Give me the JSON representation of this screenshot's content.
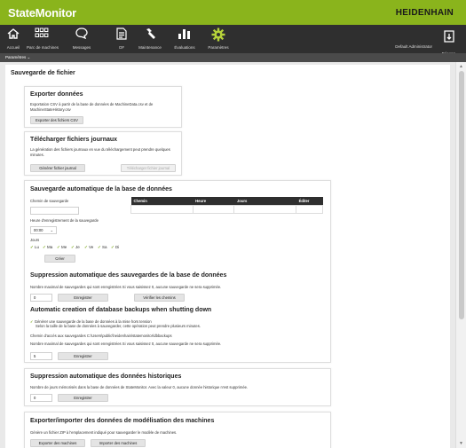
{
  "app": {
    "name": "StateMonitor",
    "vendor": "HEIDENHAIN"
  },
  "nav": {
    "items": [
      {
        "label": "Accueil",
        "icon": "home-icon"
      },
      {
        "label": "Parc de machines",
        "icon": "grid-icon"
      },
      {
        "label": "Messages",
        "icon": "message-icon"
      },
      {
        "label": "OF",
        "icon": "document-icon"
      },
      {
        "label": "Maintenance",
        "icon": "wrench-icon"
      },
      {
        "label": "Évaluations",
        "icon": "bar-chart-icon"
      },
      {
        "label": "Paramètres",
        "icon": "gear-icon"
      }
    ],
    "user": "Default Administrator",
    "logout": "Déconn."
  },
  "breadcrumb": "Paramètres ⌄",
  "page_title": "Sauvegarde de fichier",
  "export": {
    "title": "Exporter données",
    "desc": "Exportation CSV à partir de la base de données de MachineData.csv et de MachineStateHistory.csv",
    "button": "Exporter des fichiers CSV"
  },
  "logs": {
    "title": "Télécharger fichiers journaux",
    "desc": "La génération des fichiers journaux en vue du téléchargement peut prendre quelques minutes.",
    "generate": "Générer fichier journal",
    "download": "Télécharger fichier journal"
  },
  "autobackup": {
    "title": "Sauvegarde automatique de la base de données",
    "path_label": "Chemin de sauvegarde",
    "path_value": "",
    "time_label": "Heure d'enregistrement de la sauvegarde",
    "time_value": "00:00",
    "days_label": "Jours",
    "days": [
      "Lu",
      "Ma",
      "Me",
      "Je",
      "Ve",
      "Sa",
      "Di"
    ],
    "create": "Créer",
    "table_headers": [
      "Chemin",
      "Heure",
      "Jours",
      "Éditer"
    ]
  },
  "autodelete": {
    "title": "Suppression automatique des sauvegardes de la base de données",
    "desc": "Nombre maximal de sauvegardes qui sont enregistrées Si vous saisissez 0, aucune sauvegarde ne sera supprimée.",
    "value": "0",
    "save": "Enregistrer",
    "check": "Vérifier les chemins"
  },
  "shutdown": {
    "title": "Automatic creation of database backups when shutting down",
    "check_text": "Générer une sauvegarde de la base de données à la mise hors tension",
    "check_sub": "Selon la taille de la base de données à sauvegarder, cette opération peut prendre plusieurs minutes.",
    "path_text": "Chemin d'accès aux sauvegardes C:\\Users\\public\\heidenhain\\statemonitor\\dbbackups",
    "desc": "Nombre maximal de sauvegardes qui sont enregistrées Si vous saisissez 0, aucune sauvegarde ne sera supprimée.",
    "value": "5",
    "save": "Enregistrer"
  },
  "history": {
    "title": "Suppression automatique des données historiques",
    "desc": "Nombre de jours mémorisés dans la base de données de StateMonitor. Avec la valeur 0, aucune donnée historique n'est supprimée.",
    "value": "0",
    "save": "Enregistrer"
  },
  "modeling": {
    "title": "Exporter/importer des données de modélisation des machines",
    "desc": "Génère un fichier ZIP à l'emplacement indiqué pour sauvegarder le modèle de machines.",
    "export": "Exporter des machines",
    "import": "Importer des machines"
  },
  "colors": {
    "accent": "#8ab41c",
    "nav": "#2f2f2f"
  }
}
